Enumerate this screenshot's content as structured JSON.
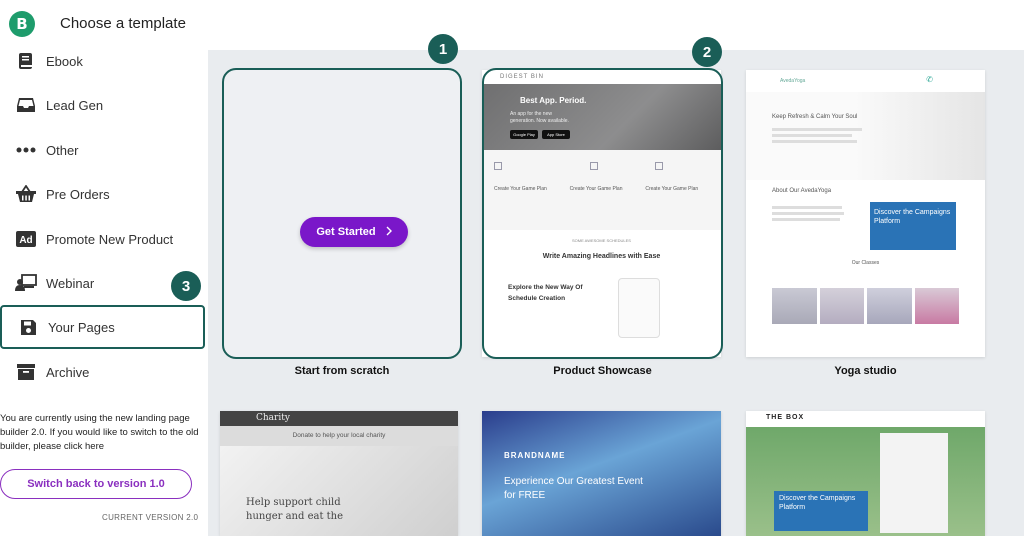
{
  "header": {
    "title": "Choose a template",
    "logo_letter": "B"
  },
  "sidebar": {
    "items": [
      {
        "label": "Ebook",
        "icon": "book-icon"
      },
      {
        "label": "Lead Gen",
        "icon": "inbox-icon"
      },
      {
        "label": "Other",
        "icon": "more-dots-icon"
      },
      {
        "label": "Pre Orders",
        "icon": "basket-icon"
      },
      {
        "label": "Promote New Product",
        "icon": "ad-icon"
      },
      {
        "label": "Webinar",
        "icon": "webinar-icon"
      },
      {
        "label": "Your Pages",
        "icon": "save-icon"
      },
      {
        "label": "Archive",
        "icon": "archive-icon"
      }
    ],
    "active_index": 6,
    "notice": "You are currently using the new landing page builder 2.0. If you would like to switch to the old builder, please click here",
    "switch_button": "Switch back to version 1.0",
    "version": "CURRENT VERSION 2.0"
  },
  "badges": [
    "1",
    "2",
    "3"
  ],
  "templates": [
    {
      "caption": "Start from scratch",
      "button": "Get Started",
      "button_color": "#7a17c9"
    },
    {
      "caption": "Product Showcase",
      "brand": "DIGEST BIN",
      "hero_title": "Best App. Period.",
      "hero_sub": "An app for the new generation. Now available.",
      "store1": "Google Play",
      "store2": "App Store",
      "feature": "Create Your Game Plan",
      "section_label": "SOME AWESOME SCHEDULES",
      "headline": "Write Amazing Headlines with Ease",
      "explore": "Explore the New Way Of Schedule Creation"
    },
    {
      "caption": "Yoga studio",
      "brand": "AvedaYoga",
      "tagline": "Keep Refresh & Calm Your Soul",
      "about": "About Our AvedaYoga",
      "discover": "Discover the Campaigns Platform",
      "classes": "Our Classes"
    },
    {
      "caption": "",
      "brand": "Charity",
      "banner": "Donate to help your local charity",
      "text": "Help support child hunger and eat the"
    },
    {
      "caption": "",
      "brand": "BRANDNAME",
      "text": "Experience Our Greatest Event for FREE"
    },
    {
      "caption": "",
      "brand": "THE BOX",
      "discover": "Discover the Campaigns Platform"
    }
  ],
  "colors": {
    "accent": "#1a5e57",
    "primary_purple": "#7a17c9",
    "logo_green": "#1e9c6c",
    "main_bg": "#e9ecef"
  }
}
